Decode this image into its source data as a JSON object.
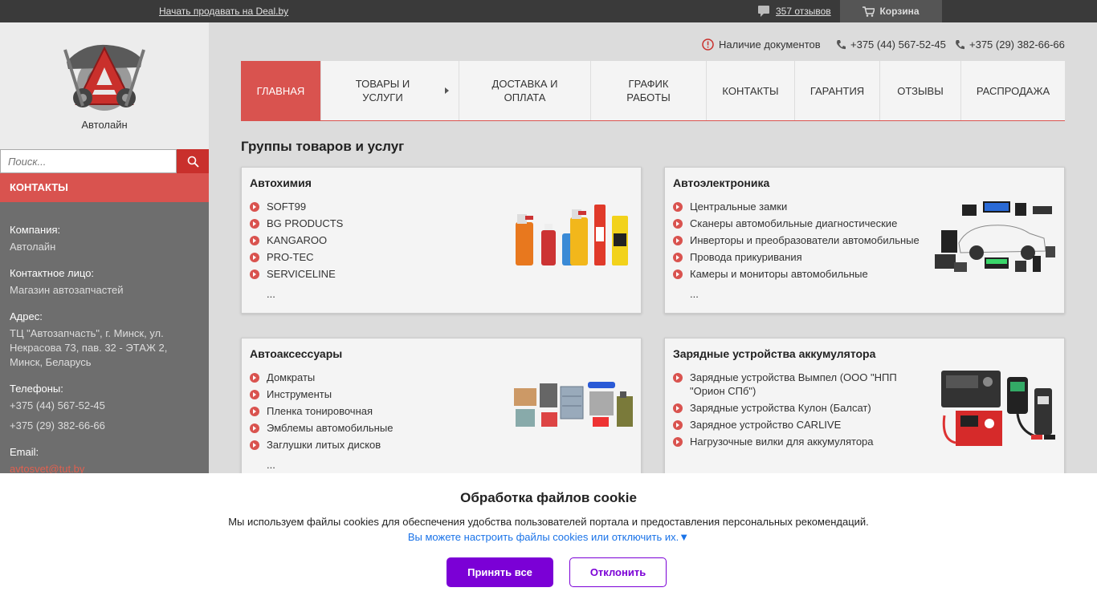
{
  "topbar": {
    "sell_link": "Начать продавать на Deal.by",
    "reviews": "357 отзывов",
    "cart": "Корзина"
  },
  "sidebar": {
    "logo_name": "Автолайн",
    "search_placeholder": "Поиск...",
    "contacts_title": "КОНТАКТЫ",
    "company_label": "Компания:",
    "company_value": "Автолайн",
    "person_label": "Контактное лицо:",
    "person_value": "Магазин автозапчастей",
    "address_label": "Адрес:",
    "address_value": "ТЦ \"Автозапчасть\", г. Минск, ул. Некрасова 73, пав. 32 - ЭТАЖ 2, Минск, Беларусь",
    "phones_label": "Телефоны:",
    "phone_1": "+375 (44) 567-52-45",
    "phone_2": "+375 (29) 382-66-66",
    "email_label": "Email:",
    "email_value": "avtosvet@tut.by"
  },
  "header": {
    "documents": "Наличие документов",
    "phone_1": "+375 (44) 567-52-45",
    "phone_2": "+375 (29) 382-66-66"
  },
  "nav": [
    {
      "label": "ГЛАВНАЯ"
    },
    {
      "label": "ТОВАРЫ И УСЛУГИ"
    },
    {
      "label": "ДОСТАВКА И ОПЛАТА"
    },
    {
      "label": "ГРАФИК РАБОТЫ"
    },
    {
      "label": "КОНТАКТЫ"
    },
    {
      "label": "ГАРАНТИЯ"
    },
    {
      "label": "ОТЗЫВЫ"
    },
    {
      "label": "РАСПРОДАЖА"
    }
  ],
  "section_title": "Группы товаров и услуг",
  "cards": [
    {
      "title": "Автохимия",
      "items": [
        "SOFT99",
        "BG PRODUCTS",
        "KANGAROO",
        "PRO-TEC",
        "SERVICELINE"
      ],
      "more": "..."
    },
    {
      "title": "Автоэлектроника",
      "items": [
        "Центральные замки",
        "Сканеры автомобильные диагностические",
        "Инверторы и преобразователи автомобильные",
        "Провода прикуривания",
        "Камеры и мониторы автомобильные"
      ],
      "more": "..."
    },
    {
      "title": "Автоаксессуары",
      "items": [
        "Домкраты",
        "Инструменты",
        "Пленка тонировочная",
        "Эмблемы автомобильные",
        "Заглушки литых дисков"
      ],
      "more": "..."
    },
    {
      "title": "Зарядные устройства аккумулятора",
      "items": [
        "Зарядные устройства Вымпел (ООО \"НПП \"Орион СПб\")",
        "Зарядные устройства Кулон (Балсат)",
        "Зарядное устройство CARLIVE",
        "Нагрузочные вилки для аккумулятора"
      ],
      "more": ""
    }
  ],
  "cookie": {
    "title": "Обработка файлов cookie",
    "text": "Мы используем файлы cookies для обеспечения удобства пользователей портала и предоставления персональных рекомендаций.",
    "link": "Вы можете настроить файлы cookies или отключить их.▼",
    "accept": "Принять все",
    "decline": "Отклонить"
  },
  "colors": {
    "accent": "#d9534f",
    "cookie_button": "#7b00d6",
    "link": "#1a73e8"
  }
}
